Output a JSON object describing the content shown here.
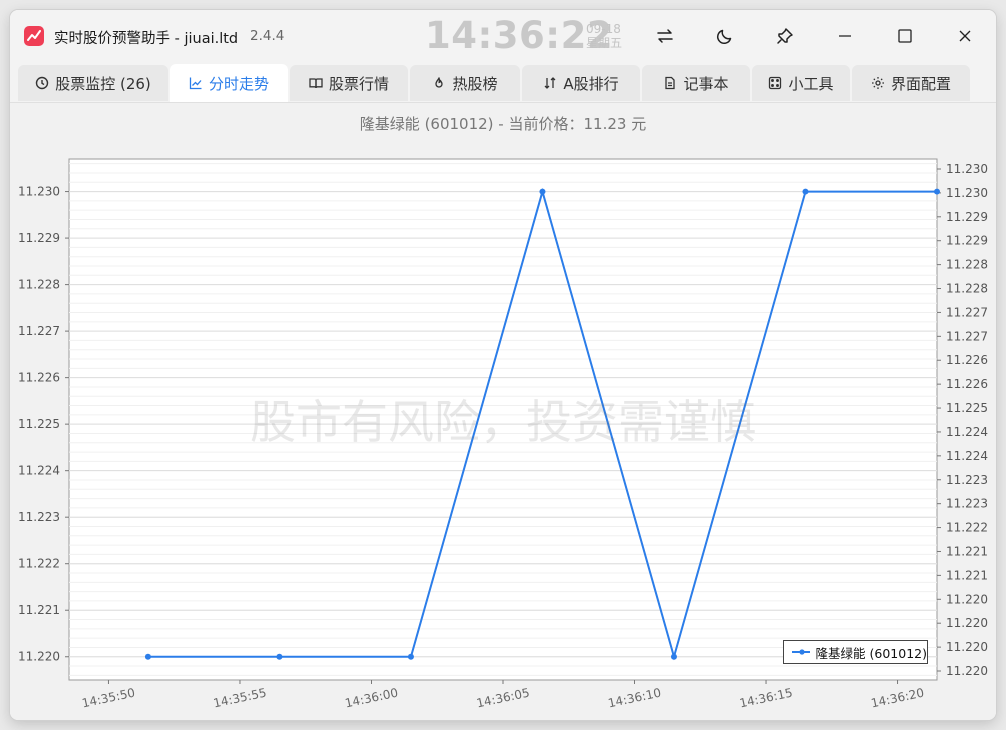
{
  "window": {
    "app_title": "实时股价预警助手 - jiuai.ltd",
    "version": "2.4.4",
    "clock_time": "14:36:22",
    "clock_date": "09-18",
    "clock_weekday": "星期五"
  },
  "titlebar_icons": [
    "swap-icon",
    "moon-icon",
    "pin-icon",
    "minimize-icon",
    "maximize-icon",
    "close-icon"
  ],
  "tabs": [
    {
      "label": "股票监控 (26)",
      "icon": "clock-icon",
      "active": false
    },
    {
      "label": "分时走势",
      "icon": "line-chart-icon",
      "active": true
    },
    {
      "label": "股票行情",
      "icon": "book-icon",
      "active": false
    },
    {
      "label": "热股榜",
      "icon": "flame-icon",
      "active": false
    },
    {
      "label": "A股排行",
      "icon": "sort-icon",
      "active": false
    },
    {
      "label": "记事本",
      "icon": "document-icon",
      "active": false
    },
    {
      "label": "小工具",
      "icon": "dice-icon",
      "active": false
    },
    {
      "label": "界面配置",
      "icon": "gear-icon",
      "active": false
    }
  ],
  "chart_header": "隆基绿能 (601012) - 当前价格：11.23 元",
  "watermark": "股市有风险，投资需谨慎",
  "colors": {
    "accent": "#2b7de9",
    "line": "#2b7de9",
    "logo": "#ef3e55"
  },
  "chart_data": {
    "type": "line",
    "xlabel": "",
    "ylabel": "",
    "x": [
      "14:35:52",
      "14:35:57",
      "14:36:02",
      "14:36:07",
      "14:36:12",
      "14:36:17",
      "14:36:22"
    ],
    "x_tick_labels": [
      "14:35:50",
      "14:35:55",
      "14:36:00",
      "14:36:05",
      "14:36:10",
      "14:36:15",
      "14:36:20"
    ],
    "x_tick_seconds": [
      50,
      55,
      60,
      65,
      70,
      75,
      80
    ],
    "x_point_seconds": [
      51.5,
      56.5,
      61.5,
      66.5,
      71.5,
      76.5,
      81.5
    ],
    "xlim_seconds": [
      48.5,
      81.5
    ],
    "series": [
      {
        "name": "隆基绿能 (601012)",
        "values": [
          11.22,
          11.22,
          11.22,
          11.23,
          11.22,
          11.23,
          11.23
        ]
      }
    ],
    "ylim": [
      11.2195,
      11.2307
    ],
    "y_left_ticks": [
      "11.220",
      "11.221",
      "11.222",
      "11.223",
      "11.224",
      "11.225",
      "11.226",
      "11.227",
      "11.228",
      "11.229",
      "11.230"
    ],
    "y_right_ticks": [
      "11.220",
      "11.220",
      "11.220",
      "11.220",
      "11.221",
      "11.221",
      "11.222",
      "11.223",
      "11.223",
      "11.224",
      "11.224",
      "11.225",
      "11.226",
      "11.226",
      "11.227",
      "11.227",
      "11.228",
      "11.228",
      "11.229",
      "11.229",
      "11.230",
      "11.230"
    ],
    "grid": true,
    "legend": "bottom-right"
  }
}
